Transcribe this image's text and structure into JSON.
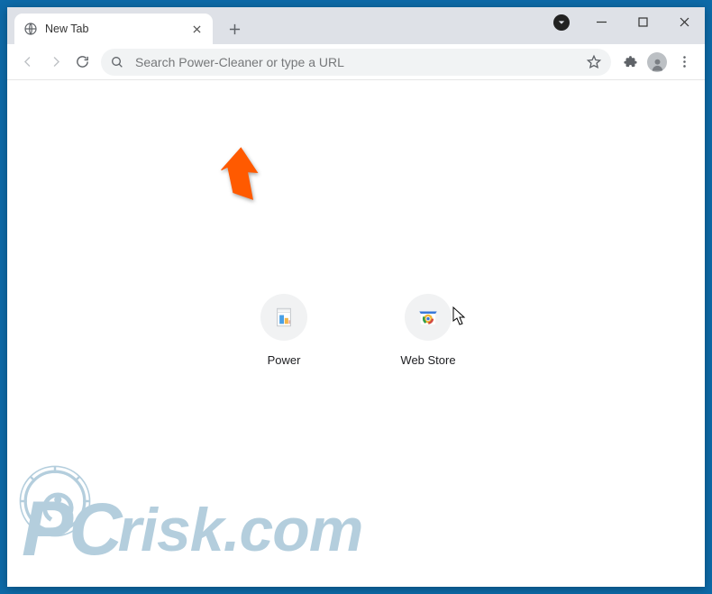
{
  "tab": {
    "title": "New Tab"
  },
  "omnibox": {
    "placeholder": "Search Power-Cleaner or type a URL"
  },
  "shortcuts": [
    {
      "label": "Power"
    },
    {
      "label": "Web Store"
    }
  ],
  "watermark": {
    "brand_p": "P",
    "brand_c": "C",
    "brand_rest": "risk",
    "url": ".com"
  }
}
